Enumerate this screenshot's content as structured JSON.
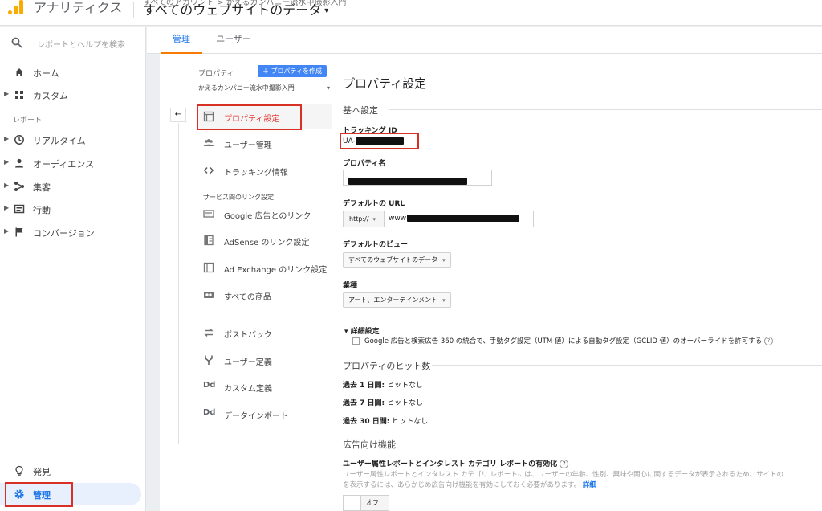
{
  "header": {
    "app_title": "アナリティクス",
    "account_crumb": "すべてのアカウント > かえるカンパニー流水中撮影入門",
    "view_title": "すべてのウェブサイトのデータ",
    "caret": "▾"
  },
  "leftnav": {
    "search_placeholder": "レポートとヘルプを検索",
    "home": "ホーム",
    "custom": "カスタム",
    "reports_section": "レポート",
    "realtime": "リアルタイム",
    "audience": "オーディエンス",
    "acquisition": "集客",
    "behavior": "行動",
    "conversions": "コンバージョン",
    "discover": "発見",
    "admin": "管理"
  },
  "tabs": {
    "admin": "管理",
    "user": "ユーザー"
  },
  "property_column": {
    "label": "プロパティ",
    "create_button": "＋ プロパティを作成",
    "selected_property": "かえるカンパニー流水中撮影入門",
    "back": "←",
    "items": {
      "property_settings": "プロパティ設定",
      "user_management": "ユーザー管理",
      "tracking_info": "トラッキング情報",
      "service_links_section": "サービス間のリンク設定",
      "google_ads_link": "Google 広告とのリンク",
      "adsense_link": "AdSense のリンク設定",
      "adexchange_link": "Ad Exchange のリンク設定",
      "all_products": "すべての商品",
      "postbacks": "ポストバック",
      "custom_definitions": "ユーザー定義",
      "custom_definitions_dd": "Dd",
      "custom_dimensions": "カスタム定義",
      "data_import_dd": "Dd",
      "data_import": "データインポート"
    }
  },
  "settings": {
    "title": "プロパティ設定",
    "basic_section": "基本設定",
    "tracking_id_label": "トラッキング ID",
    "tracking_id_prefix": "UA-",
    "property_name_label": "プロパティ名",
    "default_url_label": "デフォルトの URL",
    "protocol": "http://",
    "url_prefix": "www",
    "default_view_label": "デフォルトのビュー",
    "default_view_value": "すべてのウェブサイトのデータ",
    "industry_label": "業種",
    "industry_value": "アート、エンターテインメント",
    "advanced_toggle": "▾ 詳細設定",
    "override_checkbox_label": "Google 広告と検索広告 360 の統合で、手動タグ設定（UTM 値）による自動タグ設定（GCLID 値）のオーバーライドを許可する",
    "help": "?",
    "hits_section": "プロパティのヒット数",
    "hits_1_label": "過去 1 日間:",
    "hits_1_value": " ヒットなし",
    "hits_7_label": "過去 7 日間:",
    "hits_7_value": " ヒットなし",
    "hits_30_label": "過去 30 日間:",
    "hits_30_value": " ヒットなし",
    "ads_section": "広告向け機能",
    "demographics_label": "ユーザー属性レポートとインタレスト カテゴリ レポートの有効化",
    "demographics_desc_1": "ユーザー属性レポートとインタレスト カテゴリ レポートには、ユーザーの年齢、性別、興味や関心に関するデータが表示されるため、サイトの",
    "demographics_desc_2": "を表示するには、あらかじめ広告向け機能を有効にしておく必要があります。",
    "details_link": "詳細",
    "toggle_off": "オフ"
  },
  "colors": {
    "accent": "#1a73e8",
    "logo": "#f9ab00",
    "highlight": "#d93025",
    "create_button": "#4285f4"
  }
}
